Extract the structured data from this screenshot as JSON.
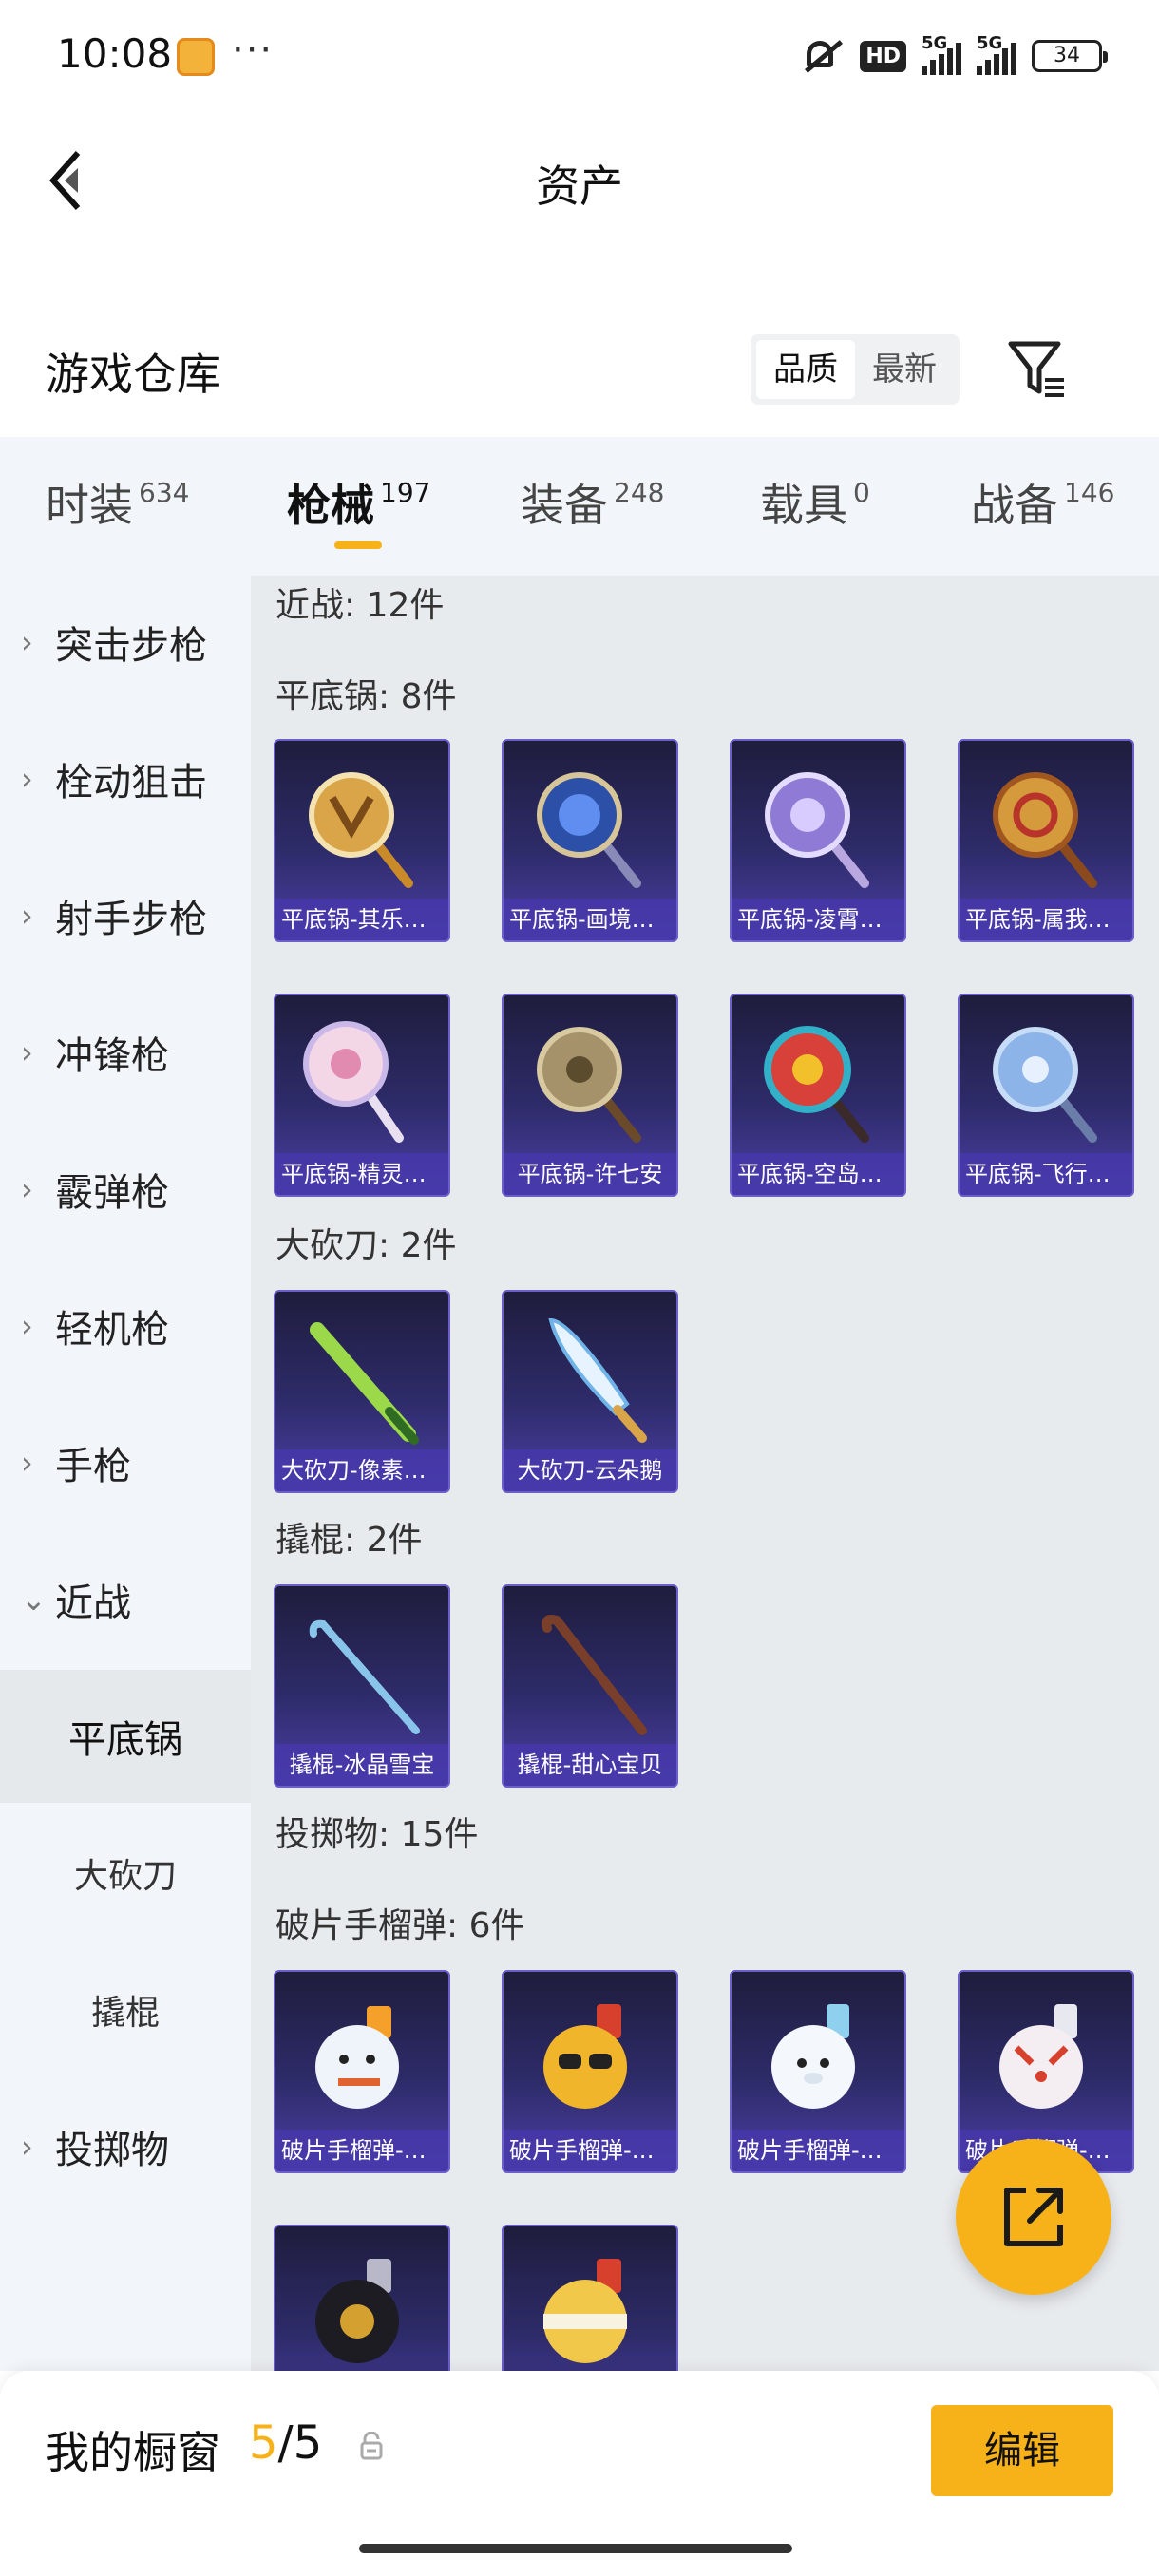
{
  "status_bar": {
    "time": "10:08",
    "dots": "···",
    "hd": "HD",
    "signal_1": "5G",
    "signal_2": "5G",
    "battery": "34"
  },
  "header": {
    "title": "资产"
  },
  "warehouse": {
    "title": "游戏仓库",
    "sort_options": [
      "品质",
      "最新"
    ],
    "active_sort": "品质"
  },
  "tabs": [
    {
      "label": "时装",
      "count": "634"
    },
    {
      "label": "枪械",
      "count": "197",
      "active": true
    },
    {
      "label": "装备",
      "count": "248"
    },
    {
      "label": "载具",
      "count": "0"
    },
    {
      "label": "战备",
      "count": "146"
    }
  ],
  "sidebar": {
    "items": [
      {
        "label": "突击步枪",
        "chevron": "›"
      },
      {
        "label": "栓动狙击",
        "chevron": "›"
      },
      {
        "label": "射手步枪",
        "chevron": "›"
      },
      {
        "label": "冲锋枪",
        "chevron": "›"
      },
      {
        "label": "霰弹枪",
        "chevron": "›"
      },
      {
        "label": "轻机枪",
        "chevron": "›"
      },
      {
        "label": "手枪",
        "chevron": "›"
      },
      {
        "label": "近战",
        "chevron": "⌄"
      }
    ],
    "subitems": [
      {
        "label": "平底锅",
        "active": true
      },
      {
        "label": "大砍刀"
      },
      {
        "label": "撬棍"
      }
    ],
    "last_item": {
      "label": "投掷物",
      "chevron": "›"
    }
  },
  "content": {
    "melee_header": "近战: 12件",
    "pan_header": "平底锅: 8件",
    "pans": [
      "平底锅-其乐融融",
      "平底锅-画境流光",
      "平底锅-凌霄之约",
      "平底锅-属我最帅",
      "平底锅-精灵之眼",
      "平底锅-许七安",
      "平底锅-空岛奇遇",
      "平底锅-飞行小鱼"
    ],
    "machete_header": "大砍刀: 2件",
    "machetes": [
      "大砍刀-像素竹刀",
      "大砍刀-云朵鹅"
    ],
    "crowbar_header": "撬棍: 2件",
    "crowbars": [
      "撬棍-冰晶雪宝",
      "撬棍-甜心宝贝"
    ],
    "throwable_header": "投掷物: 15件",
    "frag_header": "破片手榴弹: 6件",
    "frags": [
      "破片手榴弹-雪人",
      "破片手榴弹-墨镜",
      "破片手榴弹-海豹",
      "破片手榴弹-狐狸",
      "",
      ""
    ]
  },
  "bottom": {
    "shelf_label": "我的橱窗",
    "shelf_current": "5",
    "shelf_sep": "/",
    "shelf_max": "5",
    "edit_label": "编辑"
  },
  "colors": {
    "accent": "#f7b21a",
    "card_bg": "#2e2b6a",
    "card_label_bg": "#4638aa"
  },
  "icons": {
    "back": "back-arrow-icon",
    "filter": "filter-icon",
    "share": "share-external-icon",
    "lock": "lock-icon"
  }
}
